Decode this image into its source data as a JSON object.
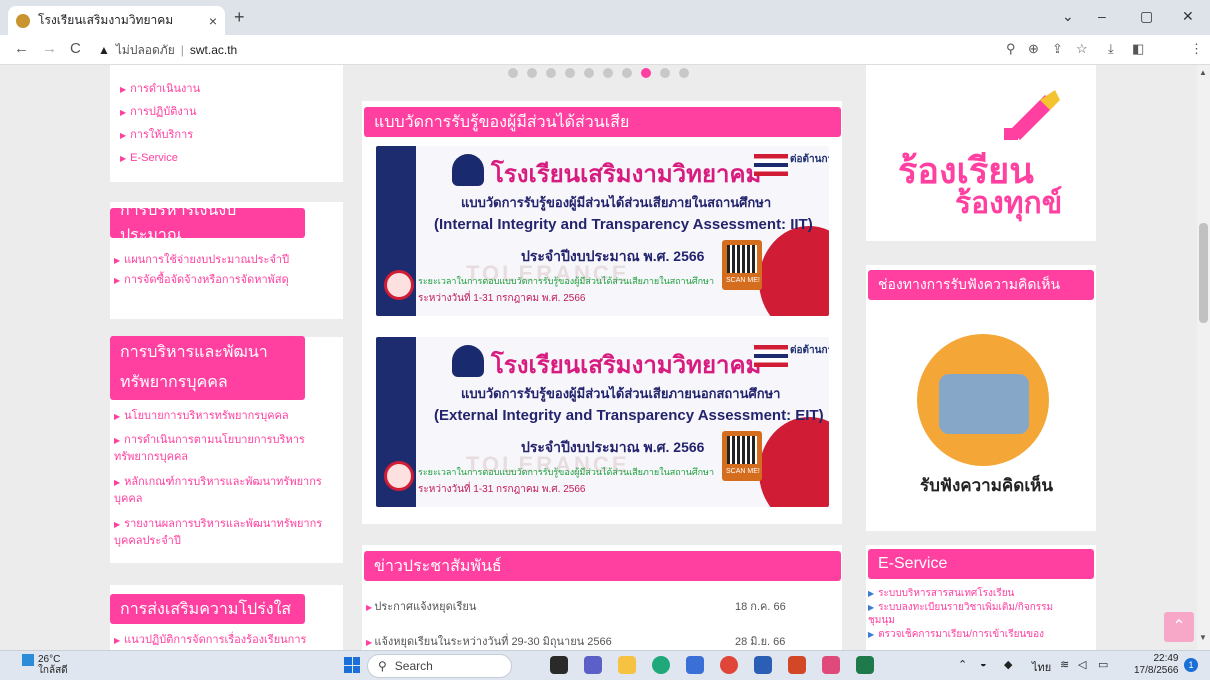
{
  "browser": {
    "tab_title": "โรงเรียนเสริมงามวิทยาคม",
    "tab_close": "×",
    "new_tab": "+",
    "not_secure": "ไม่ปลอดภัย",
    "url_sep": "|",
    "host": "swt.ac.th",
    "back": "←",
    "forward": "→",
    "reload": "C",
    "minimize": "–",
    "maximize": "▢",
    "close": "✕",
    "chevron": "⌄"
  },
  "left_sidebar": {
    "top_links": [
      "การดำเนินงาน",
      "การปฏิบัติงาน",
      "การให้บริการ",
      "E-Service"
    ],
    "budget": {
      "title": "การบริหารเงินงบประมาณ",
      "links": [
        "แผนการใช้จ่ายงบประมาณประจำปี",
        "การจัดซื้อจัดจ้างหรือการจัดหาพัสดุ"
      ]
    },
    "hr": {
      "title_line1": "การบริหารและพัฒนา",
      "title_line2": "ทรัพยากรบุคคล",
      "links": [
        [
          "นโยบายการบริหารทรัพยากรบุคคล"
        ],
        [
          "การดำเนินการตามนโยบายการบริหาร",
          "ทรัพยากรบุคคล"
        ],
        [
          "หลักเกณฑ์การบริหารและพัฒนาทรัพยากร",
          "บุคคล"
        ],
        [
          "รายงานผลการบริหารและพัฒนาทรัพยากร",
          "บุคคลประจำปี"
        ]
      ]
    },
    "transparency": {
      "title": "การส่งเสริมความโปร่งใส",
      "links": [
        "แนวปฏิบัติการจัดการเรื่องร้องเรียนการ"
      ]
    }
  },
  "carousel": {
    "dot_count": 10,
    "active_index": 7
  },
  "survey": {
    "title": "แบบวัดการรับรู้ของผู้มีส่วนได้ส่วนเสีย",
    "banners": [
      {
        "school": "โรงเรียนเสริมงามวิทยาคม",
        "sub": "แบบวัดการรับรู้ของผู้มีส่วนได้ส่วนเสียภายในสถานศึกษา",
        "english": "(Internal Integrity and Transparency Assessment: IIT)",
        "fiscal": "ประจำปีงบประมาณ พ.ศ. 2566",
        "period": "ระยะเวลาในการตอบแบบวัดการรับรู้ของผู้มีส่วนได้ส่วนเสียภายในสถานศึกษา",
        "dates": "ระหว่างวันที่ 1-31 กรกฎาคม พ.ศ. 2566",
        "watermark": "TOLERANCE",
        "scan": "SCAN ME!",
        "flag_text": "ต่อต้านการทุจริต"
      },
      {
        "school": "โรงเรียนเสริมงามวิทยาคม",
        "sub": "แบบวัดการรับรู้ของผู้มีส่วนได้ส่วนเสียภายนอกสถานศึกษา",
        "english": "(External Integrity and Transparency Assessment: EIT)",
        "fiscal": "ประจำปีงบประมาณ พ.ศ. 2566",
        "period": "ระยะเวลาในการตอบแบบวัดการรับรู้ของผู้มีส่วนได้ส่วนเสียภายในสถานศึกษา",
        "dates": "ระหว่างวันที่ 1-31 กรกฎาคม พ.ศ. 2566",
        "watermark": "TOLERANCE",
        "scan": "SCAN ME!",
        "flag_text": "ต่อต้านการทุจริต"
      }
    ]
  },
  "news": {
    "title": "ข่าวประชาสัมพันธ์",
    "items": [
      {
        "text": "ประกาศแจ้งหยุดเรียน",
        "date": "18 ก.ค. 66"
      },
      {
        "text": "แจ้งหยุดเรียนในระหว่างวันที่ 29-30 มิถุนายน 2566",
        "date": "28 มิ.ย. 66"
      }
    ]
  },
  "right_sidebar": {
    "complaint_line1": "ร้องเรียน",
    "complaint_line2": "ร้องทุกข์",
    "opinion_title": "ช่องทางการรับฟังความคิดเห็น",
    "opinion_label": "รับฟังความคิดเห็น",
    "eservice_title": "E-Service",
    "eservice_links": [
      "ระบบบริหารสารสนเทศโรงเรียน",
      "ระบบลงทะเบียนรายวิชาเพิ่มเติม/กิจกรรม",
      "ชุมนุม",
      "ตรวจเช็คการมาเรียน/การเข้าเรียนของ"
    ]
  },
  "taskbar": {
    "temp": "26°C",
    "weather": "ใกล้สดี",
    "search": "Search",
    "lang": "ไทย",
    "time": "22:49",
    "date": "17/8/2566",
    "notifications": "1"
  }
}
